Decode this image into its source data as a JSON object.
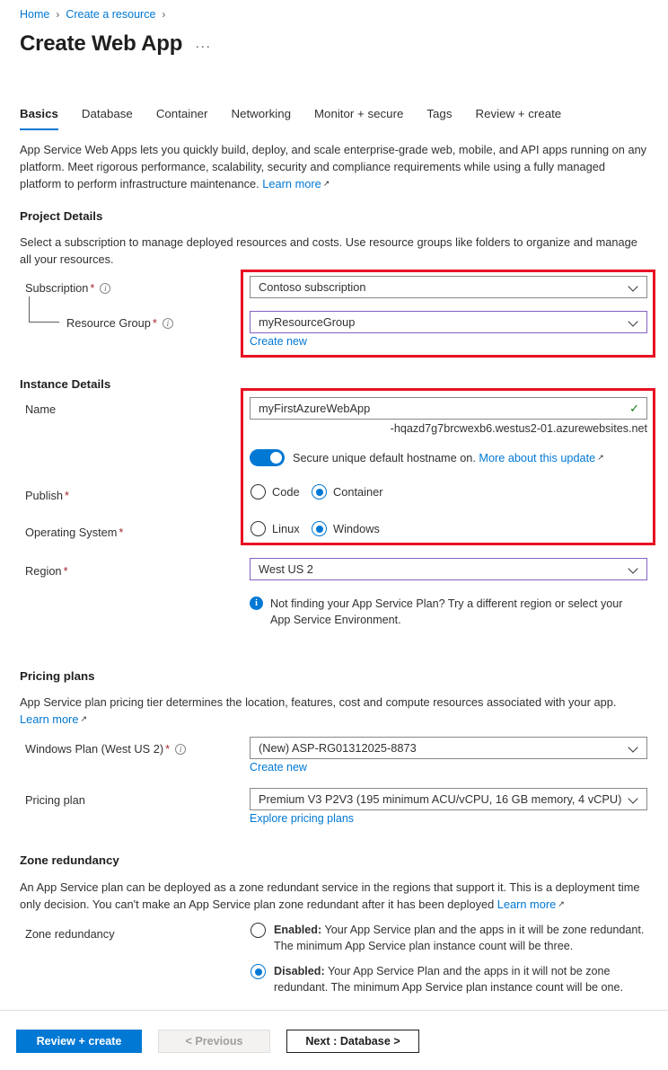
{
  "breadcrumb": {
    "items": [
      {
        "label": "Home"
      },
      {
        "label": "Create a resource"
      }
    ],
    "separator": "›"
  },
  "header": {
    "title": "Create Web App",
    "more_actions": "···"
  },
  "tabs": [
    {
      "label": "Basics",
      "active": true
    },
    {
      "label": "Database",
      "active": false
    },
    {
      "label": "Container",
      "active": false
    },
    {
      "label": "Networking",
      "active": false
    },
    {
      "label": "Monitor + secure",
      "active": false
    },
    {
      "label": "Tags",
      "active": false
    },
    {
      "label": "Review + create",
      "active": false
    }
  ],
  "intro": {
    "text": "App Service Web Apps lets you quickly build, deploy, and scale enterprise-grade web, mobile, and API apps running on any platform. Meet rigorous performance, scalability, security and compliance requirements while using a fully managed platform to perform infrastructure maintenance.",
    "learn_more": "Learn more"
  },
  "project_details": {
    "heading": "Project Details",
    "description": "Select a subscription to manage deployed resources and costs. Use resource groups like folders to organize and manage all your resources.",
    "subscription": {
      "label": "Subscription",
      "required": "*",
      "value": "Contoso subscription"
    },
    "resource_group": {
      "label": "Resource Group",
      "required": "*",
      "value": "myResourceGroup",
      "create_new": "Create new"
    }
  },
  "instance_details": {
    "heading": "Instance Details",
    "name": {
      "label": "Name",
      "value": "myFirstAzureWebApp",
      "validation_icon": "✓",
      "hostname_suffix": "-hqazd7g7brcwexb6.westus2-01.azurewebsites.net"
    },
    "secure_hostname": {
      "toggle_state": "on",
      "text": "Secure unique default hostname on.",
      "link": "More about this update"
    },
    "publish": {
      "label": "Publish",
      "required": "*",
      "options": [
        {
          "label": "Code",
          "selected": false
        },
        {
          "label": "Container",
          "selected": true
        }
      ]
    },
    "operating_system": {
      "label": "Operating System",
      "required": "*",
      "options": [
        {
          "label": "Linux",
          "selected": false
        },
        {
          "label": "Windows",
          "selected": true
        }
      ]
    },
    "region": {
      "label": "Region",
      "required": "*",
      "value": "West US 2"
    },
    "region_note": "Not finding your App Service Plan? Try a different region or select your App Service Environment."
  },
  "pricing_plans": {
    "heading": "Pricing plans",
    "description": "App Service plan pricing tier determines the location, features, cost and compute resources associated with your app.",
    "learn_more": "Learn more",
    "windows_plan": {
      "label": "Windows Plan (West US 2)",
      "required": "*",
      "value": "(New) ASP-RG01312025-8873",
      "create_new": "Create new"
    },
    "pricing_plan": {
      "label": "Pricing plan",
      "value": "Premium V3 P2V3 (195 minimum ACU/vCPU, 16 GB memory, 4 vCPU)",
      "explore_link": "Explore pricing plans"
    }
  },
  "zone_redundancy": {
    "heading": "Zone redundancy",
    "description": "An App Service plan can be deployed as a zone redundant service in the regions that support it. This is a deployment time only decision. You can't make an App Service plan zone redundant after it has been deployed",
    "learn_more": "Learn more",
    "label": "Zone redundancy",
    "options": [
      {
        "title": "Enabled:",
        "description": "Your App Service plan and the apps in it will be zone redundant. The minimum App Service plan instance count will be three.",
        "selected": false
      },
      {
        "title": "Disabled:",
        "description": "Your App Service Plan and the apps in it will not be zone redundant. The minimum App Service plan instance count will be one.",
        "selected": true
      }
    ]
  },
  "footer": {
    "review_create": "Review + create",
    "previous": "< Previous",
    "next": "Next : Database >"
  },
  "colors": {
    "accent": "#0078d4",
    "highlight": "#e81123",
    "focus_border": "#8661c5",
    "required": "#a4262c",
    "success": "#107c10"
  }
}
